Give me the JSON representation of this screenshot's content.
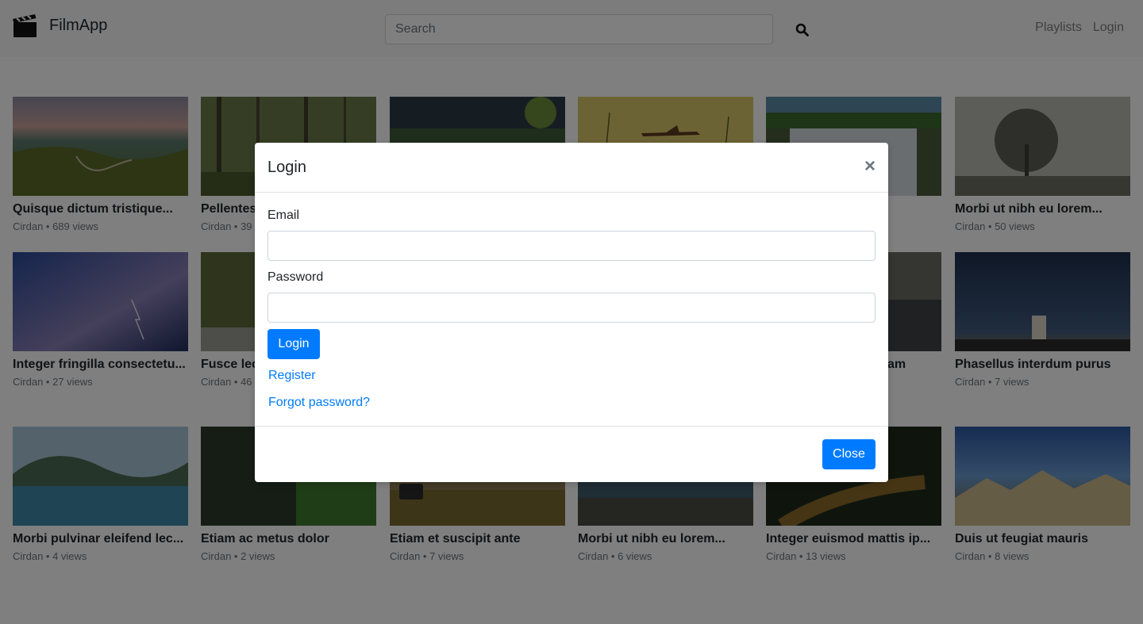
{
  "navbar": {
    "brand": "FilmApp",
    "search_placeholder": "Search",
    "links": [
      "Playlists",
      "Login"
    ]
  },
  "videos": [
    {
      "title": "Quisque dictum tristique...",
      "author": "Cirdan",
      "views": "689 views"
    },
    {
      "title": "Pellentes",
      "author": "Cirdan",
      "views": "39"
    },
    {
      "title": "",
      "author": "",
      "views": ""
    },
    {
      "title": "",
      "author": "",
      "views": ""
    },
    {
      "title": "",
      "author": "",
      "views": ""
    },
    {
      "title": "Morbi ut nibh eu lorem...",
      "author": "Cirdan",
      "views": "50 views"
    },
    {
      "title": "Integer fringilla consectetu...",
      "author": "Cirdan",
      "views": "27 views"
    },
    {
      "title": "Fusce lec",
      "author": "Cirdan",
      "views": "46"
    },
    {
      "title": "",
      "author": "",
      "views": ""
    },
    {
      "title": "",
      "author": "",
      "views": ""
    },
    {
      "title": "am",
      "author": "",
      "views": ""
    },
    {
      "title": "Phasellus interdum purus",
      "author": "Cirdan",
      "views": "7 views"
    },
    {
      "title": "Morbi pulvinar eleifend lec...",
      "author": "Cirdan",
      "views": "4 views"
    },
    {
      "title": "Etiam ac metus dolor",
      "author": "Cirdan",
      "views": "2 views"
    },
    {
      "title": "Etiam et suscipit ante",
      "author": "Cirdan",
      "views": "7 views"
    },
    {
      "title": "Morbi ut nibh eu lorem...",
      "author": "Cirdan",
      "views": "6 views"
    },
    {
      "title": "Integer euismod mattis ip...",
      "author": "Cirdan",
      "views": "13 views"
    },
    {
      "title": "Duis ut feugiat mauris",
      "author": "Cirdan",
      "views": "8 views"
    }
  ],
  "modal": {
    "title": "Login",
    "close_symbol": "×",
    "email_label": "Email",
    "password_label": "Password",
    "login_button": "Login",
    "register_link": "Register",
    "forgot_link": "Forgot password?",
    "close_button": "Close"
  },
  "colors": {
    "primary": "#007bff",
    "overlay": "rgba(0,0,0,0.5)"
  }
}
